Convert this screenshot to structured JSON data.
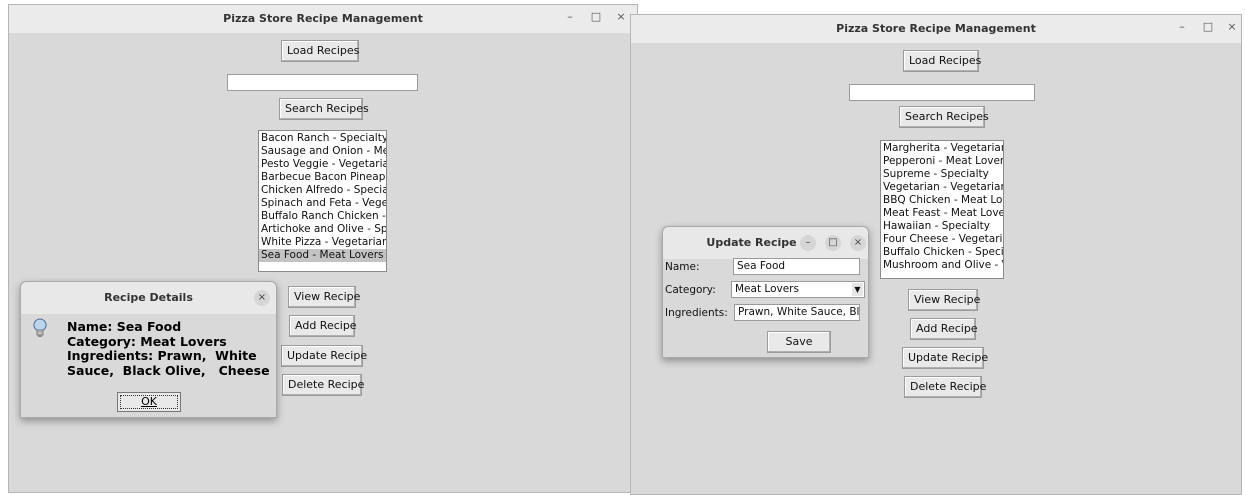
{
  "left_window": {
    "title": "Pizza Store Recipe Management",
    "controls": {
      "minimize": "–",
      "maximize": "□",
      "close": "×"
    },
    "load_button": "Load Recipes",
    "search_value": "",
    "search_button": "Search Recipes",
    "recipes": [
      "Bacon Ranch - Specialty",
      "Sausage and Onion - Meat Lovers",
      "Pesto Veggie - Vegetarian",
      "Barbecue Bacon Pineapple",
      "Chicken Alfredo - Specialty",
      "Spinach and Feta - Vegetarian",
      "Buffalo Ranch Chicken - ",
      "Artichoke and Olive - Specialty",
      "White Pizza - Vegetarian",
      "Sea Food - Meat Lovers"
    ],
    "selected_index": 9,
    "buttons": {
      "view": "View Recipe",
      "add": "Add Recipe",
      "update": "Update Recipe",
      "delete": "Delete Recipe"
    },
    "details_dialog": {
      "title": "Recipe Details",
      "close": "×",
      "icon": "lightbulb-icon",
      "message_lines": [
        "Name: Sea Food",
        "Category: Meat Lovers",
        "Ingredients: Prawn,  White",
        "Sauce,  Black Olive,   Cheese"
      ],
      "ok_label": "OK"
    }
  },
  "right_window": {
    "title": "Pizza Store Recipe Management",
    "controls": {
      "minimize": "–",
      "maximize": "□",
      "close": "×"
    },
    "load_button": "Load Recipes",
    "search_value": "",
    "search_button": "Search Recipes",
    "recipes": [
      "Margherita - Vegetarian",
      "Pepperoni - Meat Lovers",
      "Supreme - Specialty",
      "Vegetarian - Vegetarian",
      "BBQ Chicken - Meat Lovers",
      "Meat Feast - Meat Lovers",
      "Hawaiian - Specialty",
      "Four Cheese - Vegetarian",
      "Buffalo Chicken - Specialty",
      "Mushroom and Olive - Vegetarian"
    ],
    "buttons": {
      "view": "View Recipe",
      "add": "Add Recipe",
      "update": "Update Recipe",
      "delete": "Delete Recipe"
    },
    "update_dialog": {
      "title": "Update Recipe",
      "controls": {
        "minimize": "–",
        "maximize": "□",
        "close": "×"
      },
      "name_label": "Name:",
      "name_value": "Sea Food",
      "category_label": "Category:",
      "category_value": "Meat Lovers",
      "ingredients_label": "Ingredients:",
      "ingredients_value": "Prawn, White Sauce, Black Olive, Cheese",
      "save_label": "Save"
    }
  }
}
